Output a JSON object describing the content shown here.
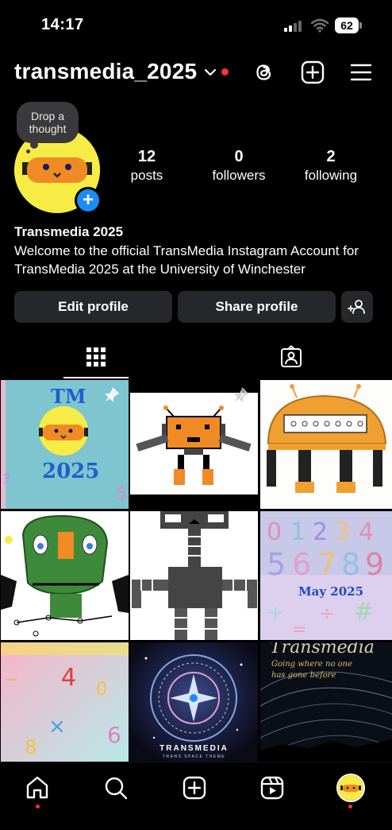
{
  "status_bar": {
    "time": "14:17",
    "battery": "62"
  },
  "header": {
    "username": "transmedia_2025"
  },
  "note": {
    "text": "Drop a thought"
  },
  "stats": [
    {
      "value": "12",
      "label": "posts"
    },
    {
      "value": "0",
      "label": "followers"
    },
    {
      "value": "2",
      "label": "following"
    }
  ],
  "profile": {
    "display_name": "Transmedia 2025",
    "bio": "Welcome to the official TransMedia Instagram Account for TransMedia 2025 at the University of Winchester"
  },
  "buttons": {
    "edit": "Edit profile",
    "share": "Share profile"
  },
  "posts": [
    {
      "tm": "TM",
      "year": "2025"
    },
    {},
    {},
    {},
    {},
    {
      "date": "May 2025"
    },
    {},
    {
      "brand": "TRANSMEDIA",
      "tag": "TRANS SPACE THEME"
    },
    {
      "title": "Transmedia",
      "quote_line1": "Going where no one",
      "quote_line2": "has gone before"
    }
  ],
  "colors": {
    "accent_blue": "#1d8cf2",
    "notification_red": "#ff3040",
    "robot_orange": "#f08a24",
    "robot_yellow": "#f7ec45"
  }
}
